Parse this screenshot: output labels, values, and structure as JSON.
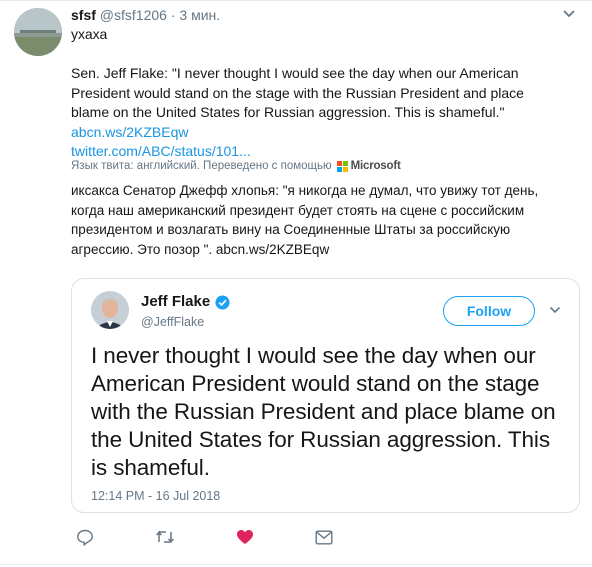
{
  "tweet": {
    "display_name": "sfsf",
    "handle": "@sfsf1206",
    "separator": "·",
    "time": "3 мин.",
    "text": "ухаха",
    "original_text": "Sen. Jeff Flake: \"I never thought I would see the day when our American President would stand on the stage with the Russian President and place blame on the United States for Russian aggression. This is shameful.\"",
    "original_link_1": "abcn.ws/2KZBEqw",
    "original_link_2": "twitter.com/ABC/status/101...",
    "translation_note": "Язык твита: английский. Переведено с помощью",
    "translation_brand": "Microsoft",
    "translated_text": "иксакса Сенатор Джефф хлопья: \"я никогда не думал, что увижу тот день, когда наш американский президент будет стоять на сцене с российским президентом и возлагать вину на Соединенные Штаты за российскую агрессию. Это позор \".",
    "translated_link": "abcn.ws/2KZBEqw"
  },
  "quoted": {
    "name": "Jeff Flake",
    "handle": "@JeffFlake",
    "follow_label": "Follow",
    "text": "I never thought I would see the day when our American President would stand on the stage with the Russian President and place blame on the United States for Russian aggression. This is shameful.",
    "timestamp": "12:14 PM - 16 Jul 2018"
  },
  "actions": {
    "icons": [
      "reply-icon",
      "retweet-icon",
      "like-icon",
      "message-icon"
    ],
    "like_color": "#e0245e",
    "icon_color": "#657786"
  },
  "colors": {
    "link": "#1b95e0",
    "follow": "#1da1f2",
    "secondary_text": "#657786"
  }
}
